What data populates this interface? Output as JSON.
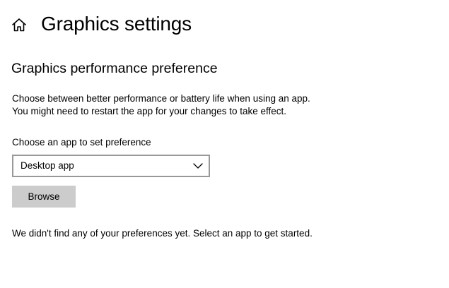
{
  "header": {
    "home_icon": "home-icon",
    "title": "Graphics settings"
  },
  "section": {
    "title": "Graphics performance preference",
    "description_line1": "Choose between better performance or battery life when using an app.",
    "description_line2": "You might need to restart the app for your changes to take effect."
  },
  "app_picker": {
    "label": "Choose an app to set preference",
    "selected_value": "Desktop app",
    "dropdown_icon": "chevron-down-icon",
    "browse_label": "Browse"
  },
  "status": {
    "message": "We didn't find any of your preferences yet. Select an app to get started."
  },
  "colors": {
    "background": "#ffffff",
    "text": "#000000",
    "select_border": "#999999",
    "button_background": "#cccccc"
  }
}
